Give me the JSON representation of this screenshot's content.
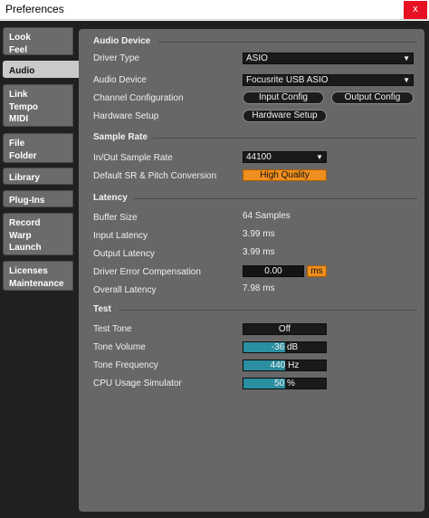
{
  "window": {
    "title": "Preferences",
    "close_label": "x"
  },
  "sidebar": {
    "tabs": [
      {
        "lines": "Look\nFeel"
      },
      {
        "lines": "Audio",
        "active": true
      },
      {
        "lines": "Link\nTempo\nMIDI"
      },
      {
        "lines": "File\nFolder"
      },
      {
        "lines": "Library"
      },
      {
        "lines": "Plug-Ins"
      },
      {
        "lines": "Record\nWarp\nLaunch"
      },
      {
        "lines": "Licenses\nMaintenance"
      }
    ]
  },
  "audio_device": {
    "heading": "Audio Device",
    "driver_type_label": "Driver Type",
    "driver_type_value": "ASIO",
    "audio_device_label": "Audio Device",
    "audio_device_value": "Focusrite USB ASIO",
    "channel_config_label": "Channel Configuration",
    "input_config_button": "Input Config",
    "output_config_button": "Output Config",
    "hardware_setup_label": "Hardware Setup",
    "hardware_setup_button": "Hardware Setup"
  },
  "sample_rate": {
    "heading": "Sample Rate",
    "in_out_label": "In/Out Sample Rate",
    "in_out_value": "44100",
    "default_sr_label": "Default SR & Pitch Conversion",
    "default_sr_value": "High Quality"
  },
  "latency": {
    "heading": "Latency",
    "buffer_size_label": "Buffer Size",
    "buffer_size_value": "64 Samples",
    "input_latency_label": "Input Latency",
    "input_latency_value": "3.99 ms",
    "output_latency_label": "Output Latency",
    "output_latency_value": "3.99 ms",
    "driver_error_label": "Driver Error Compensation",
    "driver_error_value": "0.00",
    "driver_error_unit": "ms",
    "overall_latency_label": "Overall Latency",
    "overall_latency_value": "7.98 ms"
  },
  "test": {
    "heading": "Test",
    "test_tone_label": "Test Tone",
    "test_tone_value": "Off",
    "tone_volume_label": "Tone Volume",
    "tone_volume_value": "-36 dB",
    "tone_volume_fraction": 0.5,
    "tone_frequency_label": "Tone Frequency",
    "tone_frequency_value": "440 Hz",
    "tone_frequency_fraction": 0.5,
    "cpu_sim_label": "CPU Usage Simulator",
    "cpu_sim_value": "50 %",
    "cpu_sim_fraction": 0.5
  },
  "colors": {
    "accent_orange": "#ef8f1f",
    "slider_fill": "#2a8fa0",
    "panel_bg": "#676767",
    "window_bg": "#202020"
  },
  "icons": {
    "dropdown": "triangle-down-icon",
    "close": "close-icon"
  }
}
